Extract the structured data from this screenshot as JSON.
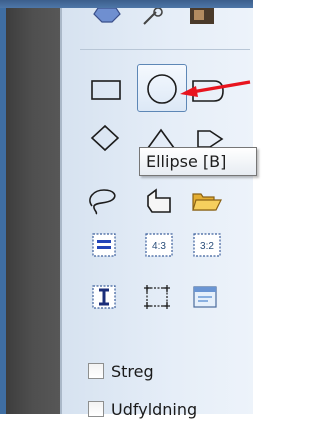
{
  "tooltip": {
    "text": "Ellipse [B]"
  },
  "toolbar": {
    "ratio_43": "4:3",
    "ratio_32": "3:2"
  },
  "options": {
    "stroke_label": "Streg",
    "fill_label": "Udfyldning"
  },
  "colors": {
    "arrow": "#e8141e",
    "tool_outline": "#1c1c1c",
    "selection_blue": "#2344b8"
  }
}
